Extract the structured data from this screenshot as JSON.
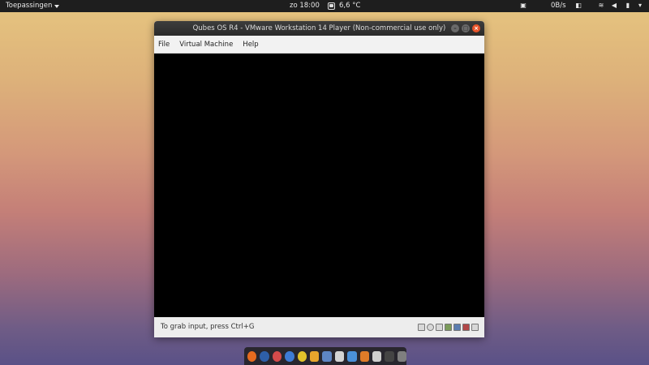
{
  "topbar": {
    "applications_label": "Toepassingen",
    "clock": "zo 18:00",
    "weather_temp": "6,6 °C",
    "net_speed": "0B/s"
  },
  "window": {
    "title": "Qubes OS R4 - VMware Workstation 14 Player (Non-commercial use only)",
    "close_glyph": "×",
    "minimize_glyph": "–",
    "maximize_glyph": "□",
    "menu": [
      "File",
      "Virtual Machine",
      "Help"
    ],
    "status_text": "To grab input, press Ctrl+G"
  },
  "device_icons": [
    "hdd-icon",
    "cd-icon",
    "pen-icon",
    "network-icon",
    "usb-icon",
    "audio-icon",
    "display-icon"
  ],
  "dock_icons": [
    {
      "name": "firefox-icon",
      "color": "#e66b1f"
    },
    {
      "name": "thunderbird-icon",
      "color": "#2e5fa8"
    },
    {
      "name": "lifebuoy-icon",
      "color": "#d44b4b"
    },
    {
      "name": "qbittorrent-icon",
      "color": "#3d7bd5"
    },
    {
      "name": "chrome-icon",
      "color": "#e2c22b"
    },
    {
      "name": "vmware-icon",
      "color": "#e8a52c"
    },
    {
      "name": "calculator-icon",
      "color": "#5e86c4"
    },
    {
      "name": "mail-icon",
      "color": "#d4d4d4"
    },
    {
      "name": "download-icon",
      "color": "#4a90d9"
    },
    {
      "name": "settings-icon",
      "color": "#e07b28"
    },
    {
      "name": "document-icon",
      "color": "#cfcfcf"
    },
    {
      "name": "terminal-icon",
      "color": "#444444"
    },
    {
      "name": "drive-icon",
      "color": "#7f7f7f"
    }
  ]
}
